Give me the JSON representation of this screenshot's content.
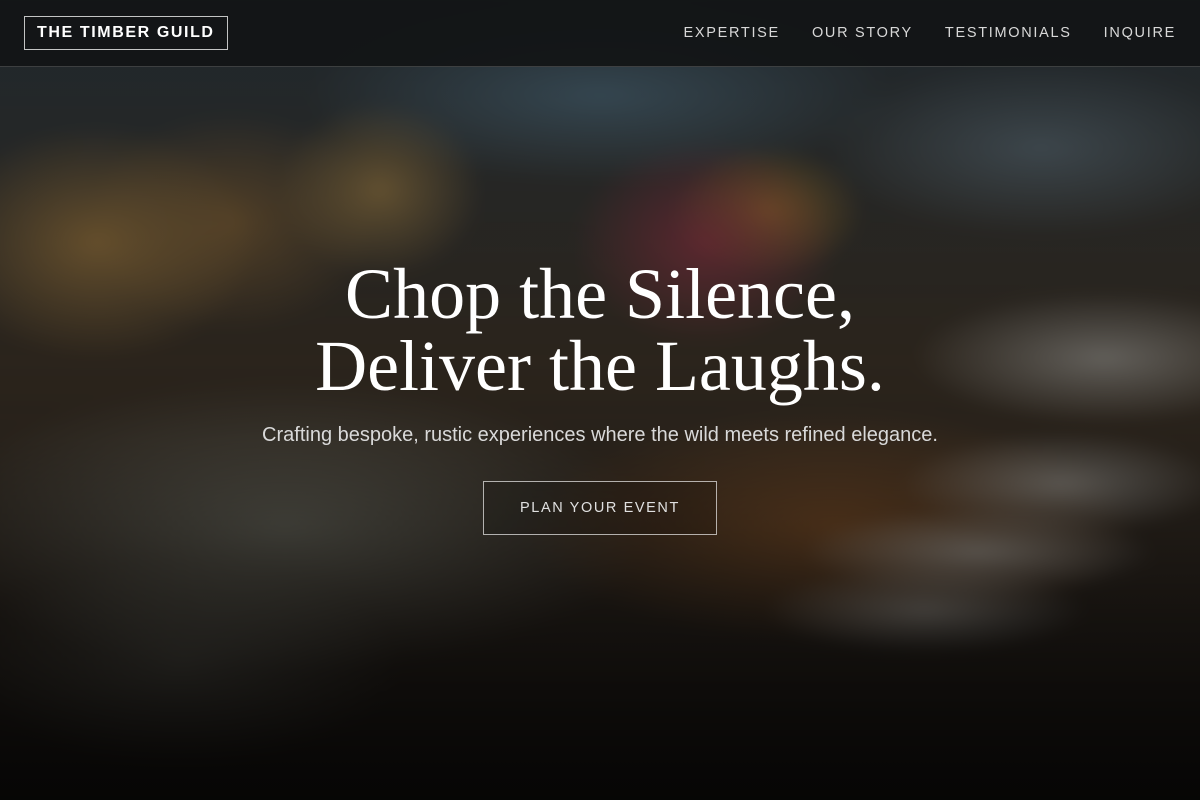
{
  "header": {
    "logo": "THE TIMBER GUILD",
    "nav": [
      {
        "label": "EXPERTISE"
      },
      {
        "label": "OUR STORY"
      },
      {
        "label": "TESTIMONIALS"
      },
      {
        "label": "INQUIRE"
      }
    ]
  },
  "hero": {
    "title_line1": "Chop the Silence,",
    "title_line2": "Deliver the Laughs.",
    "subtitle": "Crafting bespoke, rustic experiences where the wild meets refined elegance.",
    "cta_label": "PLAN YOUR EVENT",
    "background_image": "blurred banquet table with floral centerpiece and wine glasses"
  },
  "colors": {
    "header_bg": "#121416",
    "text_primary": "#ffffff",
    "text_muted": "#d8d8d8"
  }
}
